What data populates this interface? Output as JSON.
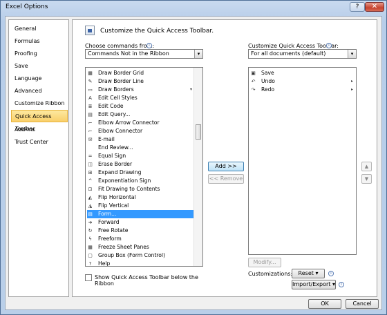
{
  "window": {
    "title": "Excel Options",
    "help_glyph": "?",
    "close_glyph": "✕"
  },
  "nav": {
    "items": [
      {
        "label": "General"
      },
      {
        "label": "Formulas"
      },
      {
        "label": "Proofing"
      },
      {
        "label": "Save"
      },
      {
        "label": "Language"
      },
      {
        "label": "Advanced"
      },
      {
        "label": "Customize Ribbon"
      },
      {
        "label": "Quick Access Toolbar",
        "selected": true
      },
      {
        "label": "Add-Ins"
      },
      {
        "label": "Trust Center"
      }
    ]
  },
  "panel": {
    "header": "Customize the Quick Access Toolbar.",
    "choose_label": "Choose commands from:",
    "choose_value": "Commands Not in the Ribbon",
    "customize_label": "Customize Quick Access Toolbar:",
    "customize_value": "For all documents (default)",
    "commands": [
      {
        "label": "Draw Border Grid",
        "icon": "▦"
      },
      {
        "label": "Draw Border Line",
        "icon": "✎"
      },
      {
        "label": "Draw Borders",
        "icon": "▭",
        "has_submenu": true
      },
      {
        "label": "Edit Cell Styles",
        "icon": "A"
      },
      {
        "label": "Edit Code",
        "icon": "≣"
      },
      {
        "label": "Edit Query...",
        "icon": "▤"
      },
      {
        "label": "Elbow Arrow Connector",
        "icon": "⌐"
      },
      {
        "label": "Elbow Connector",
        "icon": "⌐"
      },
      {
        "label": "E-mail",
        "icon": "✉"
      },
      {
        "label": "End Review...",
        "icon": ""
      },
      {
        "label": "Equal Sign",
        "icon": "="
      },
      {
        "label": "Erase Border",
        "icon": "◫"
      },
      {
        "label": "Expand Drawing",
        "icon": "⊞"
      },
      {
        "label": "Exponentiation Sign",
        "icon": "^"
      },
      {
        "label": "Fit Drawing to Contents",
        "icon": "⊡"
      },
      {
        "label": "Flip Horizontal",
        "icon": "◭"
      },
      {
        "label": "Flip Vertical",
        "icon": "◮"
      },
      {
        "label": "Form...",
        "icon": "▤",
        "selected": true
      },
      {
        "label": "Forward",
        "icon": "➜"
      },
      {
        "label": "Free Rotate",
        "icon": "↻"
      },
      {
        "label": "Freeform",
        "icon": "ϟ"
      },
      {
        "label": "Freeze Sheet Panes",
        "icon": "▦"
      },
      {
        "label": "Group Box (Form Control)",
        "icon": "▢"
      },
      {
        "label": "Help",
        "icon": "?"
      }
    ],
    "toolbar_items": [
      {
        "label": "Save",
        "icon": "▣",
        "has_submenu": false
      },
      {
        "label": "Undo",
        "icon": "↶",
        "has_submenu": true
      },
      {
        "label": "Redo",
        "icon": "↷",
        "has_submenu": true
      }
    ],
    "add_button": "Add >>",
    "remove_button": "<< Remove",
    "up_glyph": "▲",
    "down_glyph": "▼",
    "modify_button": "Modify...",
    "customizations_label": "Customizations:",
    "reset_button": "Reset",
    "import_export_button": "Import/Export",
    "dropdown_glyph": "▾",
    "info_glyph": "i",
    "show_below_label_line1": "Show Quick Access Toolbar below the",
    "show_below_label_line2": "Ribbon",
    "show_below_checked": false
  },
  "footer": {
    "ok_button": "OK",
    "cancel_button": "Cancel"
  }
}
